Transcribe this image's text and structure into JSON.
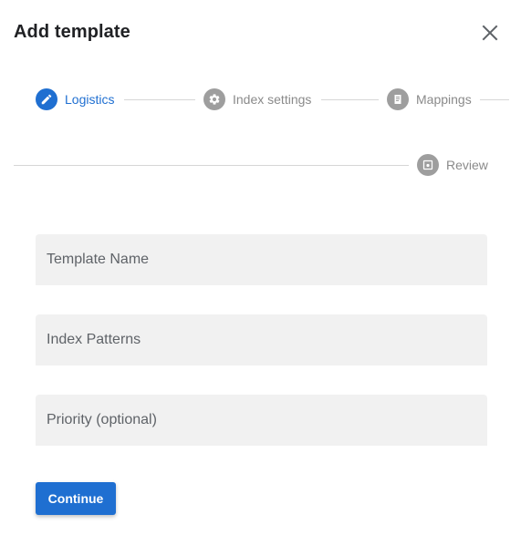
{
  "dialog": {
    "title": "Add template"
  },
  "stepper": {
    "steps": [
      {
        "label": "Logistics",
        "icon": "pencil-icon",
        "active": true
      },
      {
        "label": "Index settings",
        "icon": "gear-icon",
        "active": false
      },
      {
        "label": "Mappings",
        "icon": "document-icon",
        "active": false
      },
      {
        "label": "Review",
        "icon": "preview-icon",
        "active": false
      }
    ]
  },
  "form": {
    "template_name_placeholder": "Template Name",
    "index_patterns_placeholder": "Index Patterns",
    "priority_placeholder": "Priority (optional)",
    "template_name_value": "",
    "index_patterns_value": "",
    "priority_value": ""
  },
  "actions": {
    "continue_label": "Continue"
  },
  "colors": {
    "accent": "#1f6fd1",
    "inactive_step": "#9e9e9e",
    "field_background": "#f1f1f1"
  }
}
